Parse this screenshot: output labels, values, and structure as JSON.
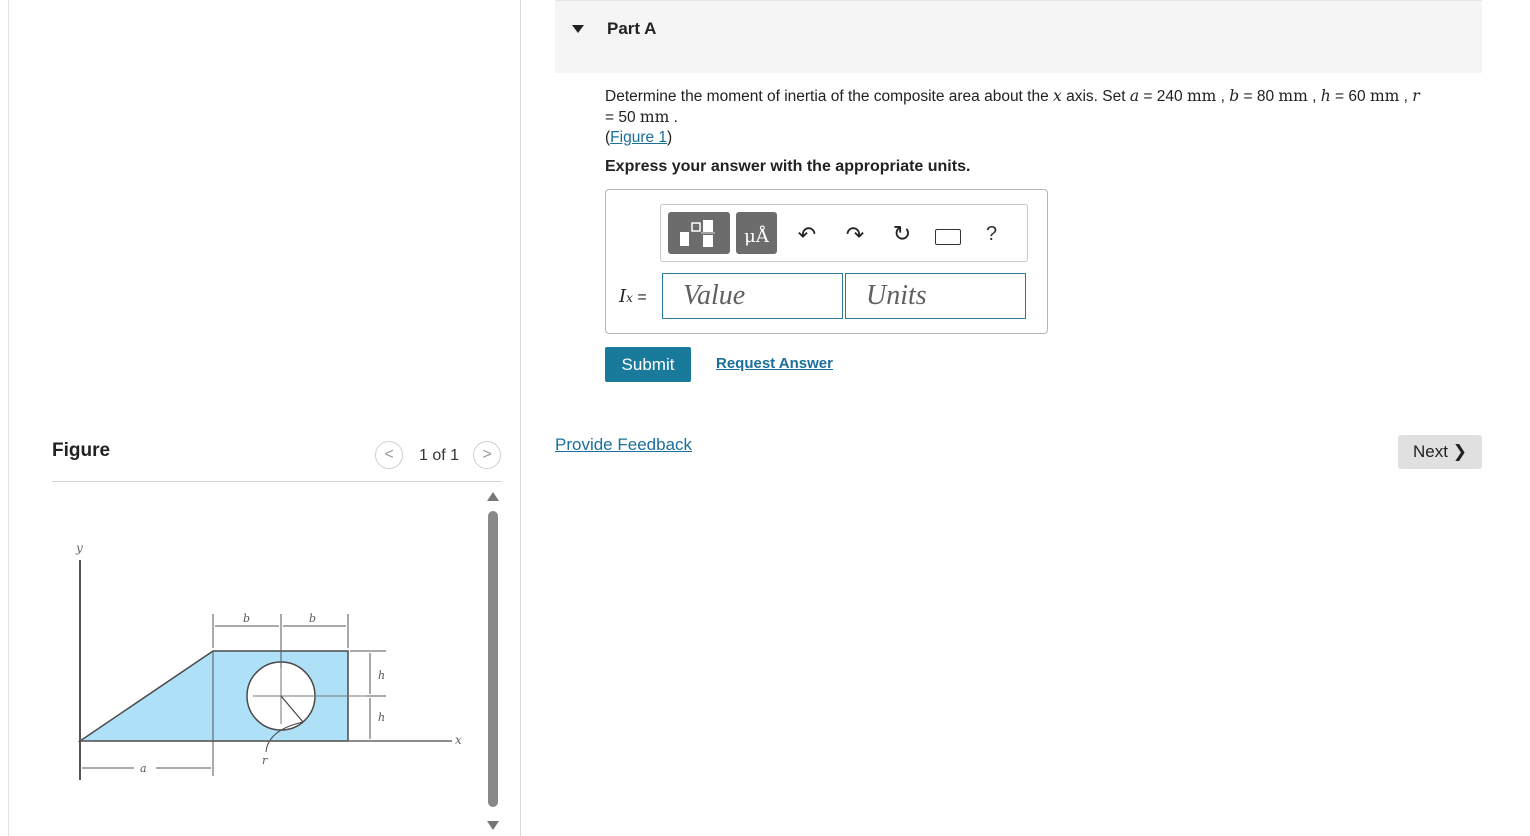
{
  "part": {
    "title": "Part A"
  },
  "question": {
    "t1": "Determine the moment of inertia of the composite area about the ",
    "x_var": "x",
    "t2": " axis. Set ",
    "a_var": "a",
    "a_val": " = 240 ",
    "unit": "mm",
    "sep": " , ",
    "b_var": "b",
    "b_val": " = 80 ",
    "h_var": "h",
    "h_val": " = 60 ",
    "r_var": "r",
    "r_val": "= 50 ",
    "period": " .",
    "figure_link": "Figure 1",
    "paren_open": "(",
    "paren_close": ")",
    "express": "Express your answer with the appropriate units."
  },
  "toolbar": {
    "units_symbol": "μÅ",
    "help": "?"
  },
  "answer": {
    "label_var": "I",
    "label_sub": "x",
    "label_eq": " =",
    "value_placeholder": "Value",
    "units_placeholder": "Units"
  },
  "actions": {
    "submit": "Submit",
    "request_answer": "Request Answer",
    "provide_feedback": "Provide Feedback",
    "next": "Next"
  },
  "figure_panel": {
    "title": "Figure",
    "pager": "1 of 1",
    "prev": "<",
    "next": ">",
    "labels": {
      "y": "y",
      "x": "x",
      "a": "a",
      "b1": "b",
      "b2": "b",
      "h1": "h",
      "h2": "h",
      "r": "r"
    }
  },
  "colors": {
    "accent": "#1a7a9c",
    "link": "#1b6f9a",
    "shape_fill": "#aee0f7"
  }
}
